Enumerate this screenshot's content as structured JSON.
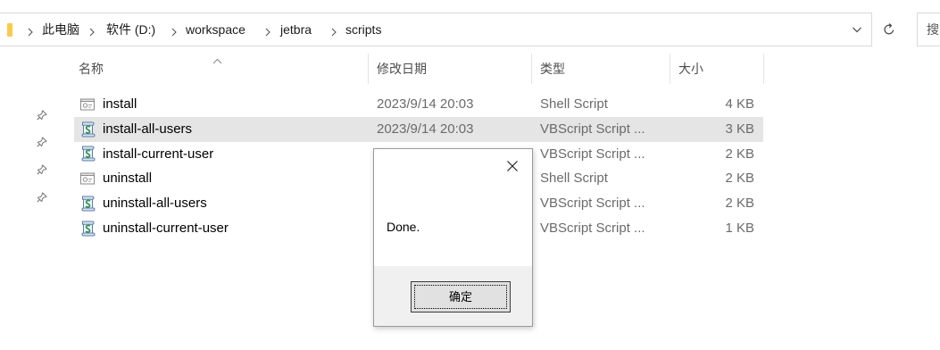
{
  "theme": {
    "selected_row": "#e5e5e5",
    "folder_icon": "#f8cb4e",
    "dialog_footer": "#f0f0f0"
  },
  "address_bar": {
    "breadcrumb": [
      "此电脑",
      "软件 (D:)",
      "workspace",
      "jetbra",
      "scripts"
    ]
  },
  "search": {
    "placeholder": "搜"
  },
  "columns": {
    "name": "名称",
    "modified": "修改日期",
    "type": "类型",
    "size": "大小",
    "sort_icon": "sort-ascending-icon"
  },
  "files": [
    {
      "name": "install",
      "modified": "2023/9/14 20:03",
      "type": "Shell Script",
      "size": "4 KB",
      "icon": "shell-script-icon"
    },
    {
      "name": "install-all-users",
      "modified": "2023/9/14 20:03",
      "type": "VBScript Script ...",
      "size": "3 KB",
      "icon": "vbscript-icon",
      "selected": true
    },
    {
      "name": "install-current-user",
      "type": "VBScript Script ...",
      "size": "2 KB",
      "icon": "vbscript-icon"
    },
    {
      "name": "uninstall",
      "type": "Shell Script",
      "size": "2 KB",
      "icon": "shell-script-icon"
    },
    {
      "name": "uninstall-all-users",
      "type": "VBScript Script ...",
      "size": "2 KB",
      "icon": "vbscript-icon"
    },
    {
      "name": "uninstall-current-user",
      "type": "VBScript Script ...",
      "size": "1 KB",
      "icon": "vbscript-icon"
    }
  ],
  "dialog": {
    "message": "Done.",
    "ok_label": "确定"
  }
}
